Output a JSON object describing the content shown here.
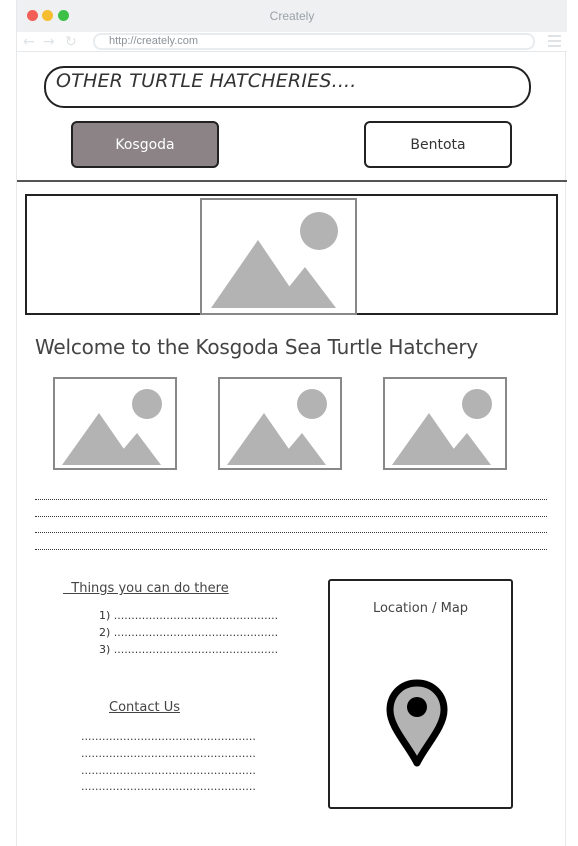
{
  "window": {
    "title": "Creately",
    "url": "http://creately.com"
  },
  "page": {
    "header": "OTHER TURTLE HATCHERIES....",
    "buttons": [
      {
        "label": "Kosgoda",
        "active": true
      },
      {
        "label": "Bentota",
        "active": false
      }
    ],
    "welcome_title": "Welcome to the Kosgoda Sea Turtle Hatchery",
    "things": {
      "title": "  Things you can do there",
      "items": [
        "1) ...............................................",
        "2) ...............................................",
        "3) ..............................................."
      ]
    },
    "contact": {
      "title": "Contact Us",
      "lines": [
        "..................................................",
        "..................................................",
        "..................................................",
        ".................................................."
      ]
    },
    "map": {
      "label": "Location / Map"
    }
  },
  "colors": {
    "active_button": "#8c8387",
    "placeholder_gray": "#b3b3b3",
    "border": "#222222"
  }
}
